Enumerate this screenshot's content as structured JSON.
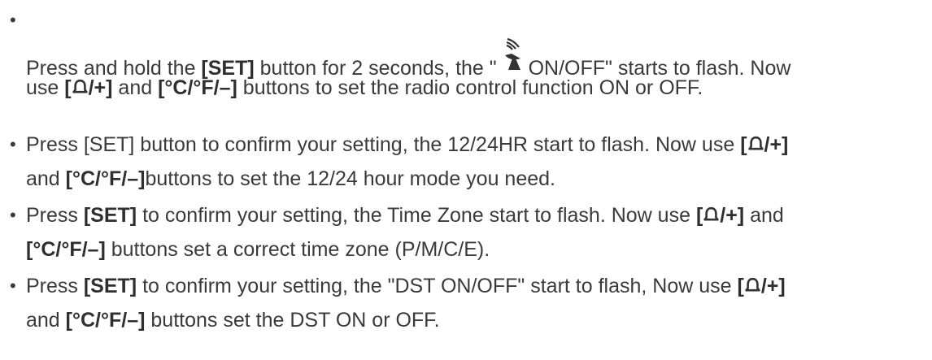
{
  "items": [
    {
      "segments": [
        {
          "t": "Press and hold the "
        },
        {
          "t": "[SET]",
          "bold": true
        },
        {
          "t": " button for 2 seconds, the \" "
        },
        {
          "icon": "satellite-dish-icon"
        },
        {
          "t": "ON/OFF\" starts to flash. Now"
        },
        {
          "br": true
        },
        {
          "t": "use "
        },
        {
          "t": "[",
          "bold": true
        },
        {
          "icon": "bell-icon"
        },
        {
          "t": "/+]",
          "bold": true
        },
        {
          "t": " and "
        },
        {
          "t": "[°C/°F/–]",
          "bold": true
        },
        {
          "t": " buttons to set the radio control function ON or OFF."
        }
      ]
    },
    {
      "segments": [
        {
          "t": "Press [SET] button to confirm your setting, the 12/24HR start to flash. Now use "
        },
        {
          "t": "[",
          "bold": true
        },
        {
          "icon": "bell-icon"
        },
        {
          "t": "/+]",
          "bold": true
        },
        {
          "br": true
        },
        {
          "t": "and "
        },
        {
          "t": "[°C/°F/–]",
          "bold": true
        },
        {
          "t": "buttons to set the 12/24 hour mode you need."
        }
      ]
    },
    {
      "segments": [
        {
          "t": "Press "
        },
        {
          "t": "[SET]",
          "bold": true
        },
        {
          "t": " to confirm your setting, the Time Zone start to flash. Now use "
        },
        {
          "t": "[",
          "bold": true
        },
        {
          "icon": "bell-icon"
        },
        {
          "t": "/+]",
          "bold": true
        },
        {
          "t": " and"
        },
        {
          "br": true
        },
        {
          "t": "[°C/°F/–]",
          "bold": true
        },
        {
          "t": " buttons set a correct time zone (P/M/C/E)."
        }
      ]
    },
    {
      "segments": [
        {
          "t": "Press "
        },
        {
          "t": "[SET]",
          "bold": true
        },
        {
          "t": " to confirm your setting, the \"DST ON/OFF\" start to flash, Now use "
        },
        {
          "t": "[",
          "bold": true
        },
        {
          "icon": "bell-icon"
        },
        {
          "t": "/+]",
          "bold": true
        },
        {
          "br": true
        },
        {
          "t": "and "
        },
        {
          "t": "[°C/°F/–]",
          "bold": true
        },
        {
          "t": " buttons set the DST ON or OFF."
        }
      ]
    }
  ],
  "bullet": "•",
  "colors": {
    "text": "#3a3a3a",
    "bold": "#2f2f2f",
    "icon": "#333333"
  }
}
